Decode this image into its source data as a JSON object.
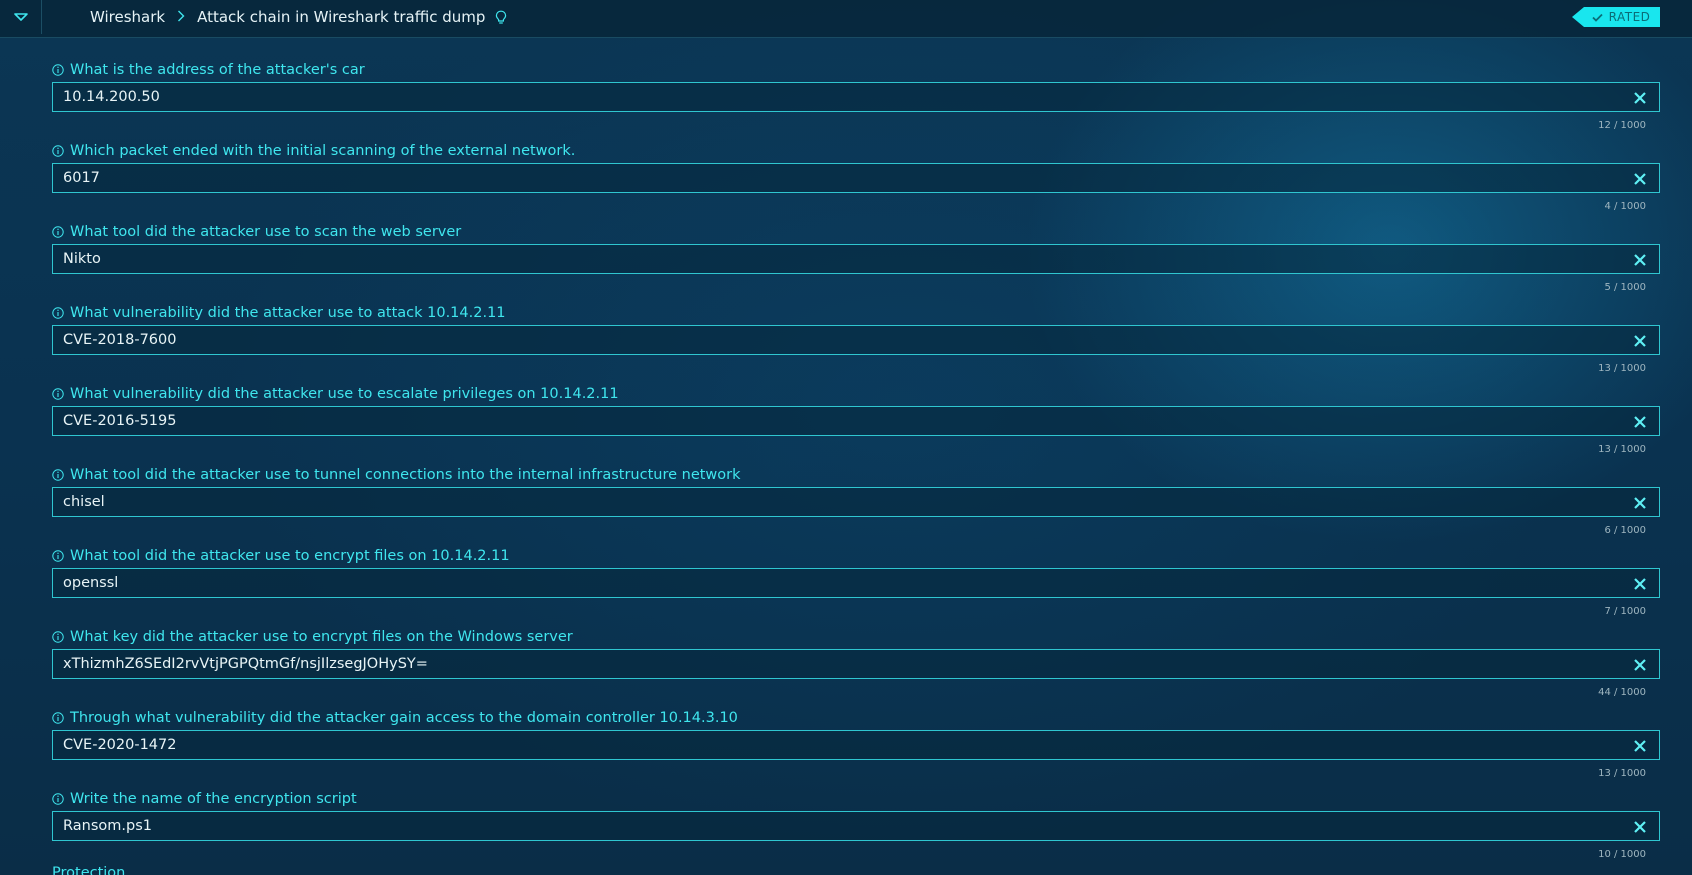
{
  "header": {
    "breadcrumb_root": "Wireshark",
    "breadcrumb_current": "Attack chain in Wireshark traffic dump",
    "status_badge": "RATED",
    "accent_color": "#19e6ee"
  },
  "questions": [
    {
      "label": "What is the address of the attacker's car",
      "answer": "10.14.200.50",
      "counter": "12 / 1000"
    },
    {
      "label": "Which packet ended with the initial scanning of the external network.",
      "answer": "6017",
      "counter": "4 / 1000"
    },
    {
      "label": "What tool did the attacker use to scan the web server",
      "answer": "Nikto",
      "counter": "5 / 1000"
    },
    {
      "label": "What vulnerability did the attacker use to attack 10.14.2.11",
      "answer": "CVE-2018-7600",
      "counter": "13 / 1000"
    },
    {
      "label": "What vulnerability did the attacker use to escalate privileges on 10.14.2.11",
      "answer": "CVE-2016-5195",
      "counter": "13 / 1000"
    },
    {
      "label": "What tool did the attacker use to tunnel connections into the internal infrastructure network",
      "answer": "chisel",
      "counter": "6 / 1000"
    },
    {
      "label": "What tool did the attacker use to encrypt files on 10.14.2.11",
      "answer": "openssl",
      "counter": "7 / 1000"
    },
    {
      "label": "What key did the attacker use to encrypt files on the Windows server",
      "answer": "xThizmhZ6SEdI2rvVtjPGPQtmGf/nsjIlzsegJOHySY=",
      "counter": "44 / 1000"
    },
    {
      "label": "Through what vulnerability did the attacker gain access to the domain controller 10.14.3.10",
      "answer": "CVE-2020-1472",
      "counter": "13 / 1000"
    },
    {
      "label": "Write the name of the encryption script",
      "answer": "Ransom.ps1",
      "counter": "10 / 1000"
    }
  ],
  "cutoff_label": "Protection"
}
